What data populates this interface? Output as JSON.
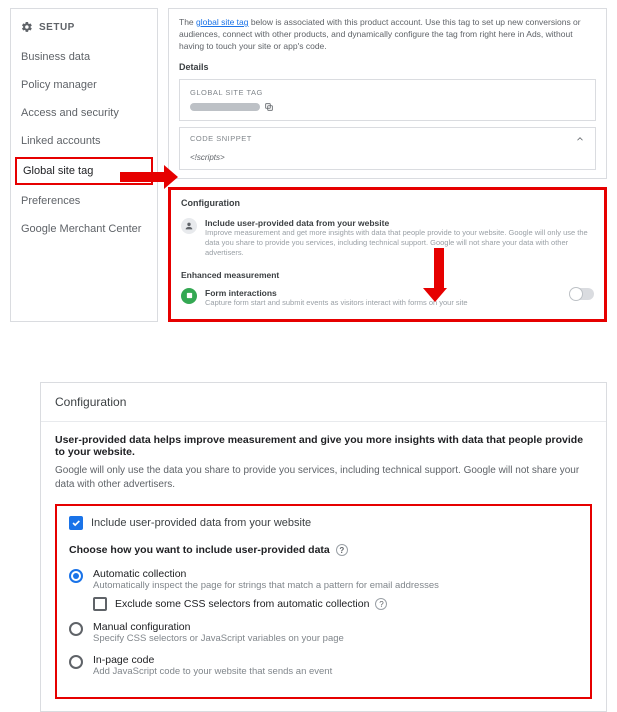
{
  "sidebar": {
    "header": "SETUP",
    "items": [
      {
        "label": "Business data"
      },
      {
        "label": "Policy manager"
      },
      {
        "label": "Access and security"
      },
      {
        "label": "Linked accounts"
      },
      {
        "label": "Global site tag"
      },
      {
        "label": "Preferences"
      },
      {
        "label": "Google Merchant Center"
      }
    ]
  },
  "intro": {
    "pre": "The ",
    "link": "global site tag",
    "post": " below is associated with this product account. Use this tag to set up new conversions or audiences, connect with other products, and dynamically configure the tag from right here in Ads, without having to touch your site or app's code.",
    "details_label": "Details",
    "gst_label": "GLOBAL SITE TAG",
    "snippet_label": "CODE SNIPPET",
    "snippet_body": "<!scripts>"
  },
  "config_small": {
    "title": "Configuration",
    "row1_title": "Include user-provided data from your website",
    "row1_desc": "Improve measurement and get more insights with data that people provide to your website. Google will only use the data you share to provide you services, including technical support. Google will not share your data with other advertisers.",
    "enhanced_label": "Enhanced measurement",
    "row2_title": "Form interactions",
    "row2_desc": "Capture form start and submit events as visitors interact with forms on your site"
  },
  "config_big": {
    "title": "Configuration",
    "bold": "User-provided data helps improve measurement and give you more insights with data that people provide to your website.",
    "desc": "Google will only use the data you share to provide you services, including technical support. Google will not share your data with other advertisers.",
    "include_label": "Include user-provided data from your website",
    "choose_label": "Choose how you want to include user-provided data",
    "opt1_title": "Automatic collection",
    "opt1_desc": "Automatically inspect the page for strings that match a pattern for email addresses",
    "opt1_sub": "Exclude some CSS selectors from automatic collection",
    "opt2_title": "Manual configuration",
    "opt2_desc": "Specify CSS selectors or JavaScript variables on your page",
    "opt3_title": "In-page code",
    "opt3_desc": "Add JavaScript code to your website that sends an event"
  }
}
